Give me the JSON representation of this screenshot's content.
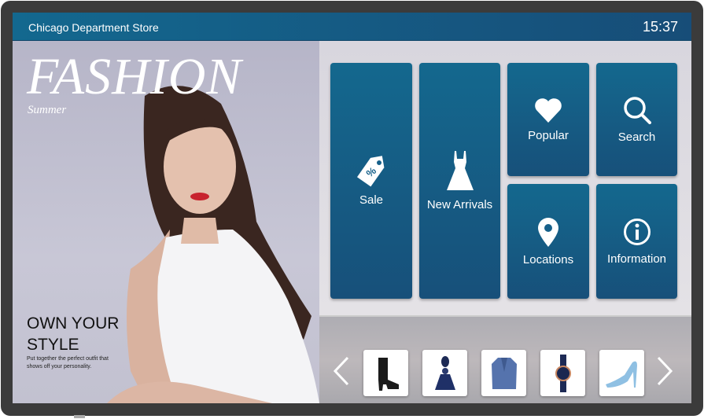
{
  "header": {
    "store_name": "Chicago Department Store",
    "time": "15:37"
  },
  "hero": {
    "title": "FASHION",
    "subtitle": "Summer",
    "headline_line1": "OWN YOUR",
    "headline_line2": "STYLE",
    "tagline": "Put together the perfect outfit that shows off your personality."
  },
  "tiles": [
    {
      "label": "Sale",
      "icon": "price-tag-icon"
    },
    {
      "label": "New Arrivals",
      "icon": "dress-icon"
    },
    {
      "label": "Popular",
      "icon": "heart-icon"
    },
    {
      "label": "Search",
      "icon": "search-icon"
    },
    {
      "label": "Locations",
      "icon": "map-pin-icon"
    },
    {
      "label": "Information",
      "icon": "info-icon"
    }
  ],
  "carousel": {
    "items": [
      "ankle-boot",
      "tassel-earring",
      "blue-blazer",
      "wristwatch",
      "blue-high-heel"
    ]
  },
  "colors": {
    "accent": "#14688e",
    "bezel": "#3b3b3b"
  }
}
